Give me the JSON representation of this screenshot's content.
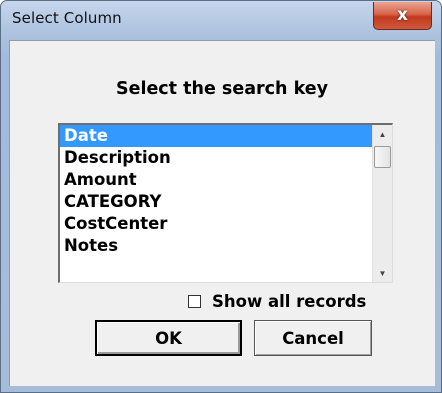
{
  "window": {
    "title": "Select Column",
    "close_glyph": "x"
  },
  "dialog": {
    "prompt": "Select the search key",
    "columns": [
      "Date",
      "Description",
      "Amount",
      "CATEGORY",
      "CostCenter",
      "Notes"
    ],
    "selected_index": 0,
    "scroll_up_glyph": "▲",
    "scroll_down_glyph": "▼",
    "show_all_label": "Show all records",
    "show_all_checked": false,
    "ok_label": "OK",
    "cancel_label": "Cancel"
  },
  "colors": {
    "selection": "#3399ff",
    "close_button": "#d0583c",
    "dialog_bg": "#f0f0f0"
  }
}
